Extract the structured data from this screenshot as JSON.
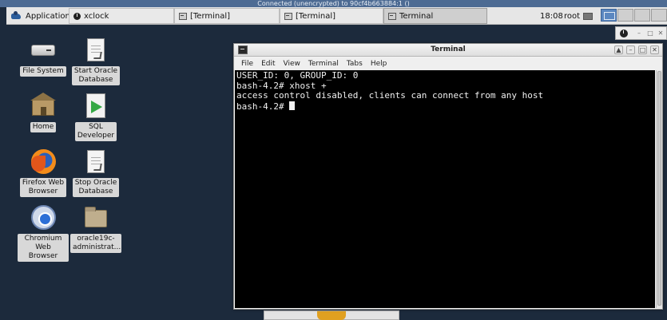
{
  "vnc": {
    "status": "Connected (unencrypted) to 90cf4b663884:1 ()"
  },
  "panel": {
    "applications_label": "Applications",
    "tasks": [
      {
        "label": "xclock",
        "icon": "clock-icon"
      },
      {
        "label": "[Terminal]",
        "icon": "terminal-icon"
      },
      {
        "label": "[Terminal]",
        "icon": "terminal-icon"
      },
      {
        "label": "Terminal",
        "icon": "terminal-icon"
      }
    ],
    "clock": "18:08",
    "user": "root"
  },
  "desktop": {
    "icons": [
      {
        "label": "File System",
        "icon": "drive-icon"
      },
      {
        "label": "Start Oracle\nDatabase",
        "icon": "script-icon"
      },
      {
        "label": "Home",
        "icon": "home-folder-icon"
      },
      {
        "label": "SQL\nDeveloper",
        "icon": "sql-developer-icon"
      },
      {
        "label": "Firefox Web\nBrowser",
        "icon": "firefox-icon"
      },
      {
        "label": "Stop Oracle\nDatabase",
        "icon": "script-icon"
      },
      {
        "label": "Chromium\nWeb Browser",
        "icon": "chromium-icon"
      },
      {
        "label": "oracle19c-\nadministrat...",
        "icon": "folder-icon"
      }
    ]
  },
  "terminal": {
    "title": "Terminal",
    "menu": [
      "File",
      "Edit",
      "View",
      "Terminal",
      "Tabs",
      "Help"
    ],
    "lines": [
      "USER_ID: 0, GROUP_ID: 0",
      "bash-4.2# xhost +",
      "access control disabled, clients can connect from any host",
      "bash-4.2# "
    ]
  },
  "colors": {
    "desktop_bg": "#1c2a3c",
    "terminal_bg": "#000000",
    "terminal_fg": "#f0f0f0",
    "active_workspace": "#5b87c0"
  }
}
